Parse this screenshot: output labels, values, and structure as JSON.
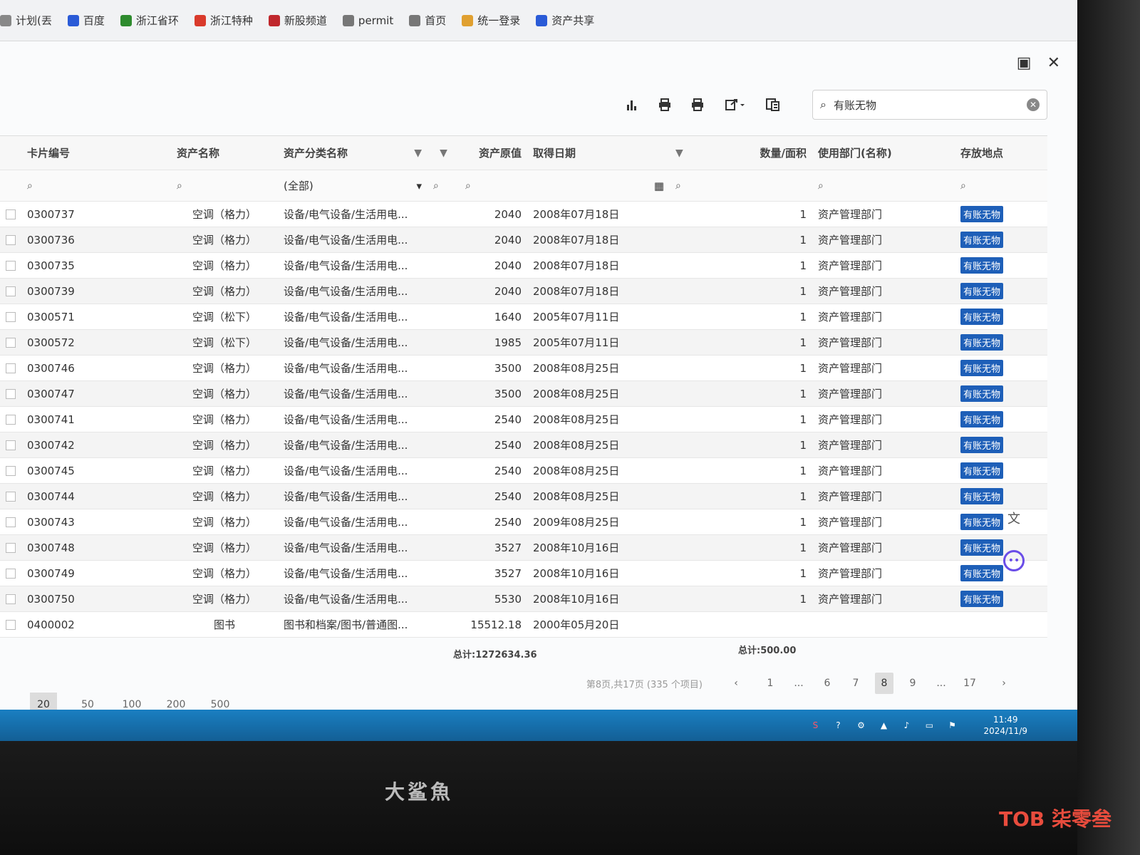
{
  "bookmarks": [
    {
      "label": "计划(丟",
      "icon": "page-icon",
      "color": "#888"
    },
    {
      "label": "百度",
      "icon": "baidu-paw-icon",
      "color": "#2a5bd7"
    },
    {
      "label": "浙江省环",
      "icon": "leaf-icon",
      "color": "#2e8b2e"
    },
    {
      "label": "浙江特种",
      "icon": "red-circle-icon",
      "color": "#d93a2b"
    },
    {
      "label": "新股频道",
      "icon": "red-square-icon",
      "color": "#c0282d"
    },
    {
      "label": "permit",
      "icon": "globe-icon",
      "color": "#777"
    },
    {
      "label": "首页",
      "icon": "globe-icon",
      "color": "#777"
    },
    {
      "label": "统一登录",
      "icon": "folder-icon",
      "color": "#e0a030"
    },
    {
      "label": "资产共享",
      "icon": "grid-icon",
      "color": "#2a5bd7"
    }
  ],
  "search": {
    "value": "有账无物"
  },
  "columns": {
    "card_no": "卡片编号",
    "asset_name": "资产名称",
    "category": "资产分类名称",
    "value": "资产原值",
    "date": "取得日期",
    "qty": "数量/面积",
    "dept": "使用部门(名称)",
    "location": "存放地点"
  },
  "filters": {
    "category_select": "(全部)"
  },
  "rows": [
    {
      "card_no": "0300737",
      "name": "空调（格力）",
      "category": "设备/电气设备/生活用电...",
      "value": "2040",
      "date": "2008年07月18日",
      "qty": "1",
      "dept": "资产管理部门",
      "loc": "有账无物"
    },
    {
      "card_no": "0300736",
      "name": "空调（格力）",
      "category": "设备/电气设备/生活用电...",
      "value": "2040",
      "date": "2008年07月18日",
      "qty": "1",
      "dept": "资产管理部门",
      "loc": "有账无物"
    },
    {
      "card_no": "0300735",
      "name": "空调（格力）",
      "category": "设备/电气设备/生活用电...",
      "value": "2040",
      "date": "2008年07月18日",
      "qty": "1",
      "dept": "资产管理部门",
      "loc": "有账无物"
    },
    {
      "card_no": "0300739",
      "name": "空调（格力）",
      "category": "设备/电气设备/生活用电...",
      "value": "2040",
      "date": "2008年07月18日",
      "qty": "1",
      "dept": "资产管理部门",
      "loc": "有账无物"
    },
    {
      "card_no": "0300571",
      "name": "空调（松下）",
      "category": "设备/电气设备/生活用电...",
      "value": "1640",
      "date": "2005年07月11日",
      "qty": "1",
      "dept": "资产管理部门",
      "loc": "有账无物"
    },
    {
      "card_no": "0300572",
      "name": "空调（松下）",
      "category": "设备/电气设备/生活用电...",
      "value": "1985",
      "date": "2005年07月11日",
      "qty": "1",
      "dept": "资产管理部门",
      "loc": "有账无物"
    },
    {
      "card_no": "0300746",
      "name": "空调（格力）",
      "category": "设备/电气设备/生活用电...",
      "value": "3500",
      "date": "2008年08月25日",
      "qty": "1",
      "dept": "资产管理部门",
      "loc": "有账无物"
    },
    {
      "card_no": "0300747",
      "name": "空调（格力）",
      "category": "设备/电气设备/生活用电...",
      "value": "3500",
      "date": "2008年08月25日",
      "qty": "1",
      "dept": "资产管理部门",
      "loc": "有账无物"
    },
    {
      "card_no": "0300741",
      "name": "空调（格力）",
      "category": "设备/电气设备/生活用电...",
      "value": "2540",
      "date": "2008年08月25日",
      "qty": "1",
      "dept": "资产管理部门",
      "loc": "有账无物"
    },
    {
      "card_no": "0300742",
      "name": "空调（格力）",
      "category": "设备/电气设备/生活用电...",
      "value": "2540",
      "date": "2008年08月25日",
      "qty": "1",
      "dept": "资产管理部门",
      "loc": "有账无物"
    },
    {
      "card_no": "0300745",
      "name": "空调（格力）",
      "category": "设备/电气设备/生活用电...",
      "value": "2540",
      "date": "2008年08月25日",
      "qty": "1",
      "dept": "资产管理部门",
      "loc": "有账无物"
    },
    {
      "card_no": "0300744",
      "name": "空调（格力）",
      "category": "设备/电气设备/生活用电...",
      "value": "2540",
      "date": "2008年08月25日",
      "qty": "1",
      "dept": "资产管理部门",
      "loc": "有账无物"
    },
    {
      "card_no": "0300743",
      "name": "空调（格力）",
      "category": "设备/电气设备/生活用电...",
      "value": "2540",
      "date": "2009年08月25日",
      "qty": "1",
      "dept": "资产管理部门",
      "loc": "有账无物"
    },
    {
      "card_no": "0300748",
      "name": "空调（格力）",
      "category": "设备/电气设备/生活用电...",
      "value": "3527",
      "date": "2008年10月16日",
      "qty": "1",
      "dept": "资产管理部门",
      "loc": "有账无物"
    },
    {
      "card_no": "0300749",
      "name": "空调（格力）",
      "category": "设备/电气设备/生活用电...",
      "value": "3527",
      "date": "2008年10月16日",
      "qty": "1",
      "dept": "资产管理部门",
      "loc": "有账无物"
    },
    {
      "card_no": "0300750",
      "name": "空调（格力）",
      "category": "设备/电气设备/生活用电...",
      "value": "5530",
      "date": "2008年10月16日",
      "qty": "1",
      "dept": "资产管理部门",
      "loc": "有账无物"
    },
    {
      "card_no": "0400002",
      "name": "图书",
      "category": "图书和档案/图书/普通图...",
      "value": "15512.18",
      "date": "2000年05月20日",
      "qty": "",
      "dept": "",
      "loc": ""
    }
  ],
  "totals": {
    "value": "总计:1272634.36",
    "qty": "总计:500.00"
  },
  "pager": {
    "info": "第8页,共17页 (335 个项目)",
    "pages": [
      "1",
      "...",
      "6",
      "7",
      "8",
      "9",
      "...",
      "17"
    ],
    "current": "8",
    "prev": "‹",
    "next": "›"
  },
  "page_sizes": [
    "20",
    "50",
    "100",
    "200",
    "500"
  ],
  "page_size_current": "20",
  "taskbar": {
    "time": "11:49",
    "date": "2024/11/9"
  },
  "monitor_brand": "大鲨魚",
  "watermark": "TOB 柒零叁",
  "colors": {
    "tag_bg": "#1e5fb8",
    "taskbar": "#1a7fc2",
    "ai_icon": "#6a4de8"
  }
}
